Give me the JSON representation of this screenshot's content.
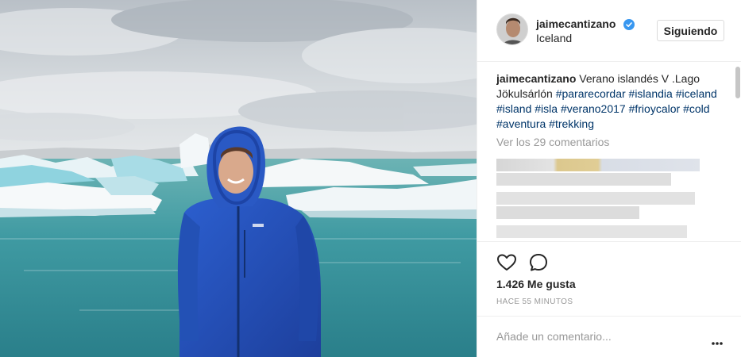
{
  "post": {
    "username": "jaimecantizano",
    "location": "Iceland",
    "follow_label": "Siguiendo",
    "caption_user": "jaimecantizano",
    "caption_text": " Verano islandés V .Lago Jökulsárlón ",
    "hashtags": [
      "#pararecordar",
      "#islandia",
      "#iceland",
      "#island",
      "#isla",
      "#verano2017",
      "#frioycalor",
      "#cold",
      "#aventura",
      "#trekking"
    ],
    "view_comments": "Ver los 29 comentarios",
    "likes": "1.426 Me gusta",
    "time": "HACE 55 MINUTOS",
    "comment_placeholder": "Añade un comentario...",
    "photo_alt": ""
  },
  "icons": {
    "avatar": "avatar",
    "verified": "verified-badge-icon",
    "like": "heart-icon",
    "comment": "speech-bubble-icon",
    "more": "more-options-icon"
  },
  "colors": {
    "hashtag": "#003569",
    "verified": "#3897f0",
    "muted": "#999999",
    "text": "#262626",
    "border": "#efefef",
    "jacket": "#2550b8"
  }
}
